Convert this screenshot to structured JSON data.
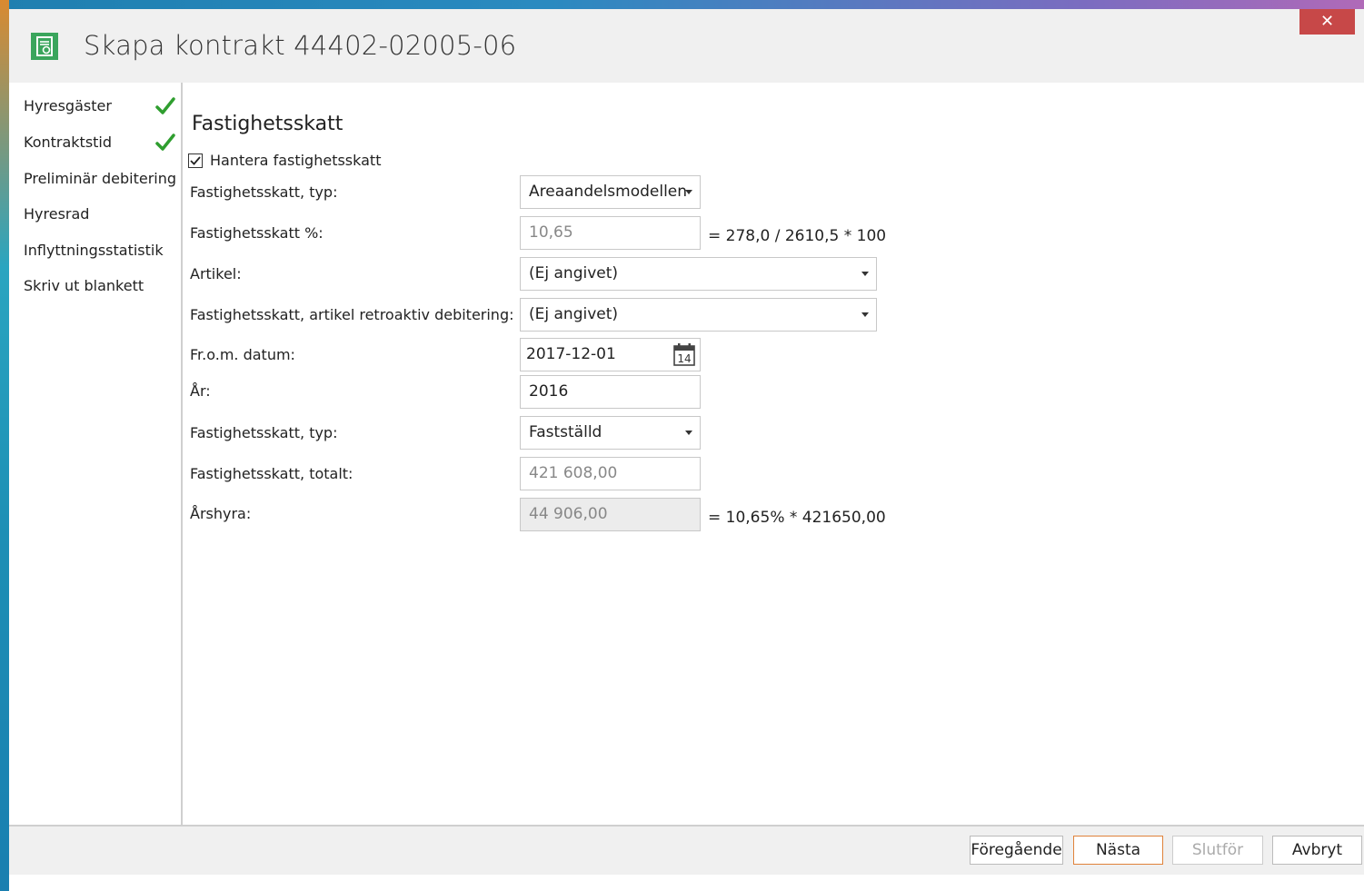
{
  "window": {
    "title": "Skapa kontrakt 44402-02005-06",
    "close_label": "✕"
  },
  "nav": {
    "items": [
      {
        "label": "Hyresgäster",
        "done": true
      },
      {
        "label": "Kontraktstid",
        "done": true
      },
      {
        "label": "Preliminär debitering",
        "done": false
      },
      {
        "label": "Hyresrad",
        "done": false
      },
      {
        "label": "Inflyttningsstatistik",
        "done": false
      },
      {
        "label": "Skriv ut blankett",
        "done": false
      }
    ]
  },
  "form": {
    "section_title": "Fastighetsskatt",
    "manage_checkbox": {
      "label": "Hantera fastighetsskatt",
      "checked": true
    },
    "tax_type_1": {
      "label": "Fastighetsskatt, typ:",
      "value": "Areaandelsmodellen"
    },
    "tax_percent": {
      "label": "Fastighetsskatt %:",
      "value": "10,65",
      "formula": "= 278,0 / 2610,5 * 100"
    },
    "article": {
      "label": "Artikel:",
      "value": "(Ej angivet)"
    },
    "retro_article": {
      "label": "Fastighetsskatt, artikel retroaktiv debitering:",
      "value": "(Ej angivet)"
    },
    "from_date": {
      "label": "Fr.o.m. datum:",
      "value": "2017-12-01",
      "calendar_day": "14"
    },
    "year": {
      "label": "År:",
      "value": "2016"
    },
    "tax_type_2": {
      "label": "Fastighetsskatt, typ:",
      "value": "Fastställd"
    },
    "tax_total": {
      "label": "Fastighetsskatt, totalt:",
      "value": "421 608,00"
    },
    "annual_rent": {
      "label": "Årshyra:",
      "value": "44 906,00",
      "formula": "= 10,65% * 421650,00"
    }
  },
  "footer": {
    "prev_label": "Föregående",
    "next_label": "Nästa",
    "finish_label": "Slutför",
    "cancel_label": "Avbryt"
  },
  "colors": {
    "accent_orange": "#e0823a",
    "check_green": "#2f9e2f",
    "close_red": "#c74848",
    "icon_green": "#3aa55c"
  }
}
